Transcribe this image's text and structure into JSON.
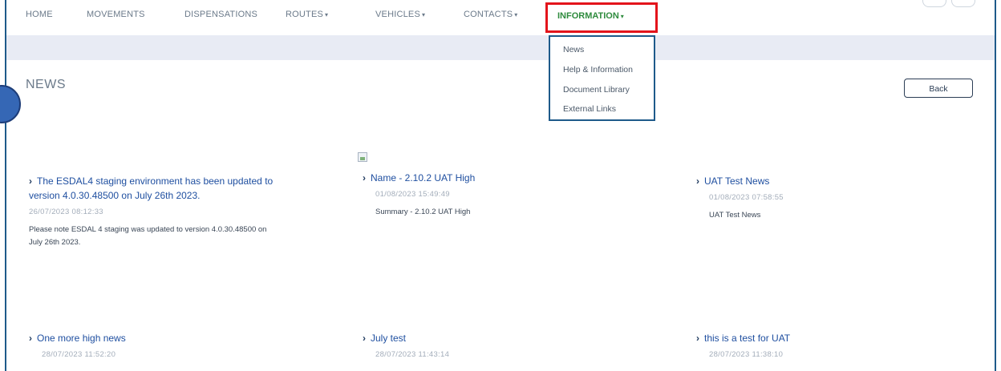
{
  "nav": {
    "home": "HOME",
    "movements": "MOVEMENTS",
    "dispensations": "DISPENSATIONS",
    "routes": "ROUTES",
    "vehicles": "VEHICLES",
    "contacts": "CONTACTS",
    "information": "INFORMATION",
    "caret": "▾"
  },
  "information_menu": {
    "items": [
      "News",
      "Help & Information",
      "Document Library",
      "External Links"
    ]
  },
  "page": {
    "title": "NEWS",
    "back_label": "Back"
  },
  "news": [
    {
      "title": "The ESDAL4 staging environment has been updated to version 4.0.30.48500 on July 26th 2023.",
      "title_line1": "The ESDAL4 staging environment has been updated to",
      "title_line2": "version 4.0.30.48500 on July 26th 2023.",
      "date": "26/07/2023 08:12:33",
      "summary_line1": "Please note ESDAL 4 staging was updated to version 4.0.30.48500 on",
      "summary_line2": "July 26th 2023."
    },
    {
      "title": "Name - 2.10.2 UAT High",
      "date": "01/08/2023 15:49:49",
      "summary": "Summary - 2.10.2 UAT High"
    },
    {
      "title": "UAT Test News",
      "date": "01/08/2023 07:58:55",
      "summary": "UAT Test News"
    },
    {
      "title": "One more high news",
      "date": "28/07/2023 11:52:20"
    },
    {
      "title": "July test",
      "date": "28/07/2023 11:43:14"
    },
    {
      "title": "this is a test for UAT",
      "date": "28/07/2023 11:38:10"
    }
  ],
  "colors": {
    "frame": "#1e5a8a",
    "highlight": "#e3141b",
    "active_nav": "#2e8b3d",
    "link": "#1f4fa0",
    "band": "#e8ebf4"
  }
}
